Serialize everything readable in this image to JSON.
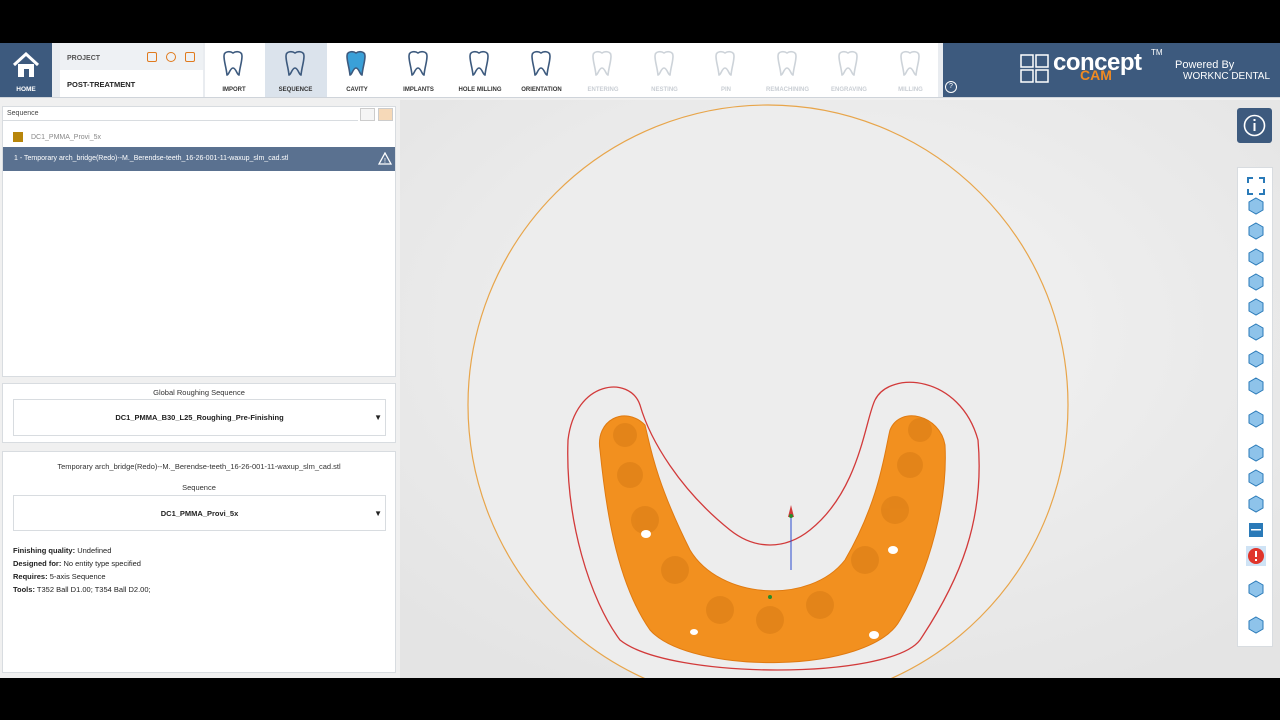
{
  "home": {
    "label": "HOME"
  },
  "project": {
    "header": "PROJECT",
    "name": "POST-TREATMENT"
  },
  "steps": [
    {
      "label": "IMPORT",
      "state": "done"
    },
    {
      "label": "SEQUENCE",
      "state": "active"
    },
    {
      "label": "CAVITY",
      "state": "done"
    },
    {
      "label": "IMPLANTS",
      "state": "done"
    },
    {
      "label": "HOLE MILLING",
      "state": "done"
    },
    {
      "label": "ORIENTATION",
      "state": "done"
    },
    {
      "label": "ENTERING",
      "state": "disabled"
    },
    {
      "label": "NESTING",
      "state": "disabled"
    },
    {
      "label": "PIN",
      "state": "disabled"
    },
    {
      "label": "REMACHINING",
      "state": "disabled"
    },
    {
      "label": "ENGRAVING",
      "state": "disabled"
    },
    {
      "label": "MILLING",
      "state": "disabled"
    }
  ],
  "brand": {
    "concept": "concept",
    "cam": "CAM",
    "tm": "TM",
    "powered": "Powered By",
    "worknc": "WORKNC DENTAL",
    "help": "?"
  },
  "sequence_panel": {
    "header": "Sequence",
    "group": "DC1_PMMA_Provi_5x",
    "item": "1 - Temporary arch_bridge(Redo)--M._Berendse-teeth_16-26-001-11-waxup_slm_cad.stl"
  },
  "global": {
    "title": "Global Roughing Sequence",
    "value": "DC1_PMMA_B30_L25_Roughing_Pre-Finishing"
  },
  "details": {
    "file": "Temporary arch_bridge(Redo)--M._Berendse-teeth_16-26-001-11-waxup_slm_cad.stl",
    "seq_title": "Sequence",
    "seq_value": "DC1_PMMA_Provi_5x",
    "finishing_label": "Finishing quality:",
    "finishing_value": "Undefined",
    "designed_label": "Designed for:",
    "designed_value": "No entity type specified",
    "requires_label": "Requires:",
    "requires_value": "5-axis Sequence",
    "tools_label": "Tools:",
    "tools_value": "T352 Ball D1.00; T354 Ball D2.00;"
  },
  "colors": {
    "accent": "#3d5a7e",
    "model": "#f2901f",
    "selection": "#5a7190",
    "outline": "#d23a3a",
    "disk": "#e8a54a"
  }
}
